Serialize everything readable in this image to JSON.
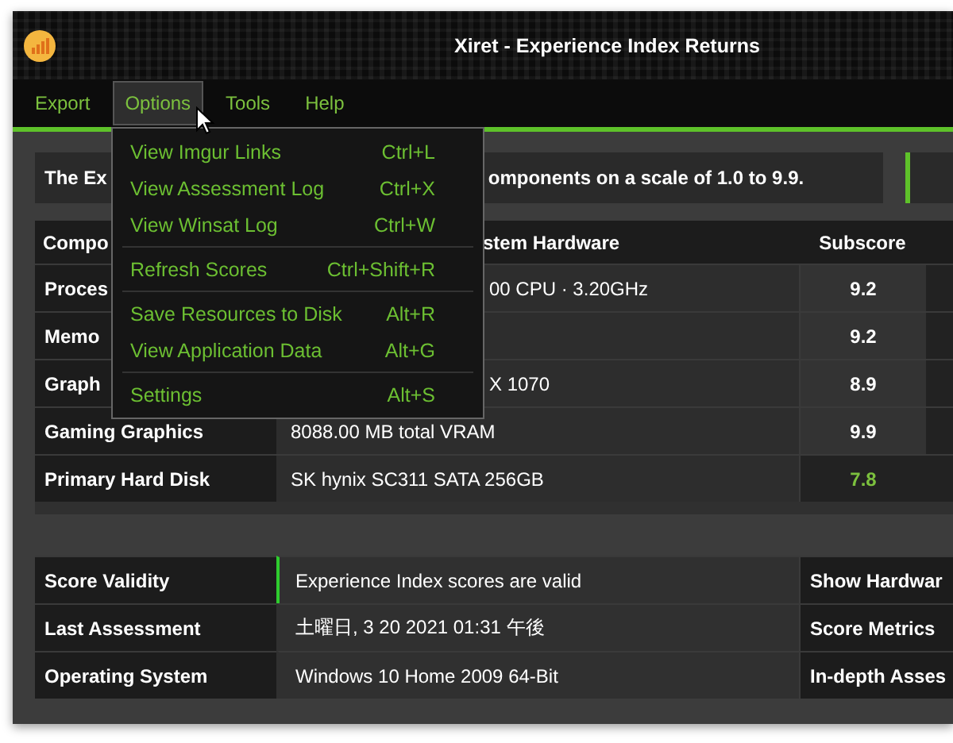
{
  "window": {
    "title": "Xiret - Experience Index Returns"
  },
  "menu_bar": [
    {
      "label": "Export",
      "selected": false
    },
    {
      "label": "Options",
      "selected": true
    },
    {
      "label": "Tools",
      "selected": false
    },
    {
      "label": "Help",
      "selected": false
    }
  ],
  "options_menu": {
    "groups": [
      [
        {
          "label": "View Imgur Links",
          "shortcut": "Ctrl+L"
        },
        {
          "label": "View Assessment Log",
          "shortcut": "Ctrl+X"
        },
        {
          "label": "View Winsat Log",
          "shortcut": "Ctrl+W"
        }
      ],
      [
        {
          "label": "Refresh Scores",
          "shortcut": "Ctrl+Shift+R"
        }
      ],
      [
        {
          "label": "Save Resources to Disk",
          "shortcut": "Alt+R"
        },
        {
          "label": "View Application Data",
          "shortcut": "Alt+G"
        }
      ],
      [
        {
          "label": "Settings",
          "shortcut": "Alt+S"
        }
      ]
    ]
  },
  "banner": {
    "text_before_menu": "The Ex",
    "text_after_menu": "omponents on a scale of 1.0 to 9.9."
  },
  "scores_table": {
    "columns": [
      {
        "label": "Compo",
        "covered": false
      },
      {
        "label": "stem Hardware",
        "covered": true
      },
      {
        "label": "Subscore",
        "covered": false
      }
    ],
    "rows": [
      {
        "component": "Proces",
        "hardware": "00 CPU · 3.20GHz",
        "hardware_covered": true,
        "subscore": "9.2",
        "lowest": false
      },
      {
        "component": "Memo",
        "subscore": "9.2",
        "lowest": false
      },
      {
        "component": "Graph",
        "hardware": "X 1070",
        "hardware_covered": true,
        "subscore": "8.9",
        "lowest": false
      },
      {
        "component": "Gaming Graphics",
        "hardware": "8088.00 MB total VRAM",
        "subscore": "9.9",
        "lowest": false
      },
      {
        "component": "Primary Hard Disk",
        "hardware": "SK hynix SC311 SATA 256GB",
        "subscore": "7.8",
        "lowest": true
      }
    ]
  },
  "info_table": {
    "rows": [
      {
        "label": "Score Validity",
        "value": "Experience Index scores are valid",
        "valid": true,
        "action": "Show Hardwar"
      },
      {
        "label": "Last Assessment",
        "value": "土曜日, 3 20 2021 01:31 午後",
        "valid": false,
        "action": "Score Metrics"
      },
      {
        "label": "Operating System",
        "value": "Windows 10 Home 2009 64-Bit",
        "valid": false,
        "action": "In-depth Asses"
      }
    ]
  }
}
